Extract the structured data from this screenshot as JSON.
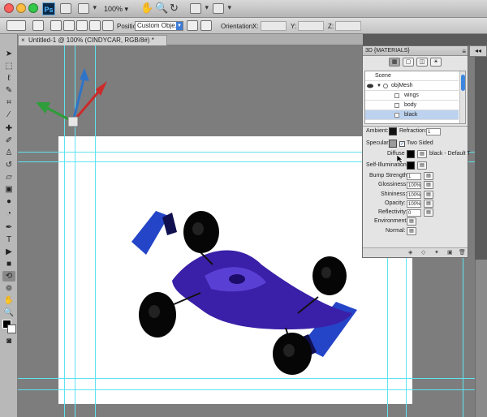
{
  "app": {
    "logo_text": "Ps",
    "zoom_label": "100%",
    "traffic_colors": [
      "#fc615d",
      "#fdbc40",
      "#34c84a"
    ]
  },
  "options_bar": {
    "position_label": "Position:",
    "position_value": "Custom Obje...",
    "orientation_label": "Orientation:",
    "x_label": "X:",
    "y_label": "Y:",
    "z_label": "Z:"
  },
  "document": {
    "tab_title": "Untitled-1 @ 100% (CINDYCAR, RGB/8#) *",
    "guide_color": "#5fe3f0",
    "car_color": "#3a1fa8"
  },
  "panel": {
    "title": "3D {MATERIALS}",
    "scene_rows": [
      {
        "label": "Scene",
        "level": 0
      },
      {
        "label": "objMesh",
        "level": 1
      },
      {
        "label": "wings",
        "level": 2
      },
      {
        "label": "body",
        "level": 2
      },
      {
        "label": "black",
        "level": 2
      }
    ],
    "props": {
      "ambient_label": "Ambient:",
      "refraction_label": "Refraction:",
      "refraction_value": "1",
      "specular_label": "Specular:",
      "two_sided_label": "Two Sided",
      "diffuse_label": "Diffuse",
      "diffuse_text": "black - Default T",
      "self_illum_label": "Self-Illumination:",
      "bump_label": "Bump Strength:",
      "bump_value": "1",
      "gloss_label": "Glossiness:",
      "gloss_value": "100%",
      "shine_label": "Shininess:",
      "shine_value": "100%",
      "opacity_label": "Opacity:",
      "opacity_value": "100%",
      "reflect_label": "Reflectivity:",
      "reflect_value": "0",
      "env_label": "Environment:",
      "normal_label": "Normal:"
    }
  }
}
